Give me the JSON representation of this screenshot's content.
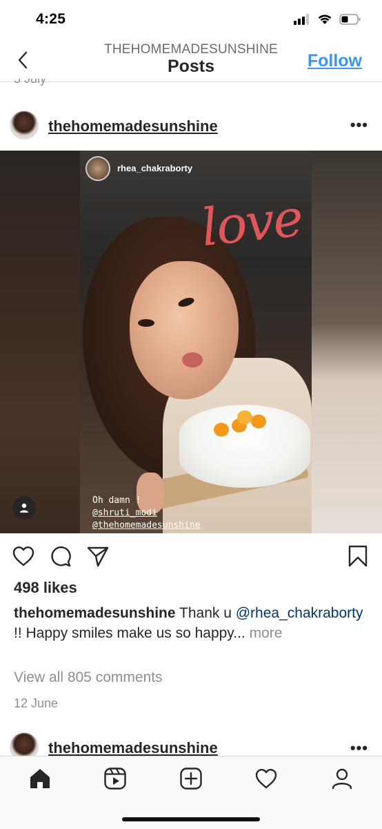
{
  "status_bar": {
    "time": "4:25",
    "icons": [
      "signal-icon",
      "wifi-icon",
      "battery-icon"
    ]
  },
  "nav": {
    "account": "THEHOMEMADESUNSHINE",
    "title": "Posts",
    "follow_label": "Follow",
    "back_icon": "chevron-left-icon"
  },
  "previous_post": {
    "date": "5 July"
  },
  "post": {
    "username": "thehomemadesunshine",
    "more_icon": "more-dots-icon",
    "story": {
      "username": "rhea_chakraborty",
      "sticker_text": "love",
      "caption_lines": [
        "Oh damn !",
        "@shruti_modi",
        "@thehomemadesunshine"
      ]
    },
    "likes": "498 likes",
    "caption_user": "thehomemadesunshine",
    "caption_text_1": " Thank u ",
    "caption_mention": "@rhea_chakraborty",
    "caption_text_2": " !! Happy smiles make us so happy...",
    "caption_more": " more",
    "view_comments": "View all 805 comments",
    "date": "12 June"
  },
  "next_post": {
    "username": "thehomemadesunshine"
  },
  "tab_bar": {
    "tabs": [
      "home-icon",
      "reels-icon",
      "new-post-icon",
      "activity-heart-icon",
      "profile-icon"
    ]
  },
  "colors": {
    "link_blue": "#3897f0",
    "mention_blue": "#00376b",
    "muted": "#8e8e8e",
    "love_red": "#e0575a"
  }
}
